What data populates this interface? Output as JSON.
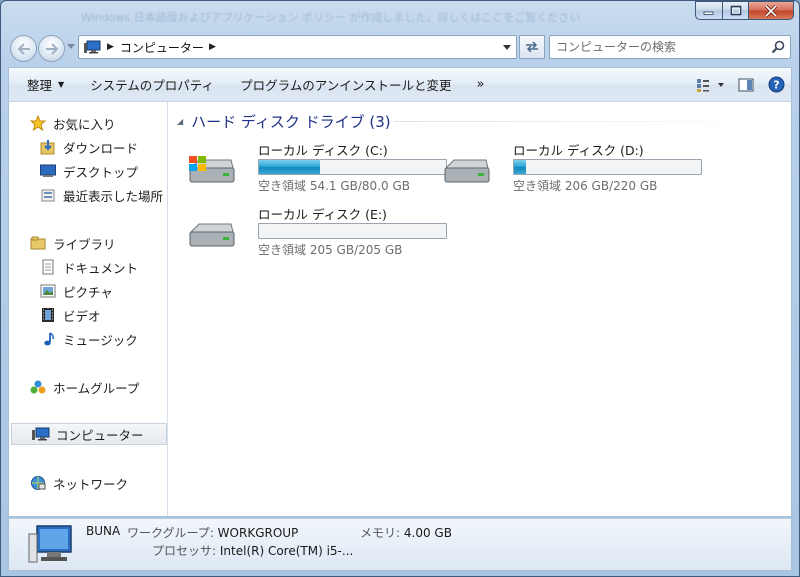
{
  "window": {
    "title_ghost": "Windows 日本語版およびアプリケーション ポリシー が作成しました。詳しくはここをご覧ください"
  },
  "address": {
    "crumb": "コンピューター"
  },
  "search": {
    "placeholder": "コンピューターの検索"
  },
  "toolbar": {
    "organize": "整理",
    "system_properties": "システムのプロパティ",
    "uninstall": "プログラムのアンインストールと変更",
    "more": "»"
  },
  "sidebar": {
    "favorites": "お気に入り",
    "downloads": "ダウンロード",
    "desktop": "デスクトップ",
    "recent": "最近表示した場所",
    "libraries": "ライブラリ",
    "documents": "ドキュメント",
    "pictures": "ピクチャ",
    "videos": "ビデオ",
    "music": "ミュージック",
    "homegroup": "ホームグループ",
    "computer": "コンピューター",
    "network": "ネットワーク"
  },
  "group": {
    "title": "ハード ディスク ドライブ (3)"
  },
  "drives": [
    {
      "name": "ローカル ディスク (C:)",
      "free_text": "空き領域 54.1 GB/80.0 GB",
      "used_fraction": 0.324
    },
    {
      "name": "ローカル ディスク (D:)",
      "free_text": "空き領域 206 GB/220 GB",
      "used_fraction": 0.064
    },
    {
      "name": "ローカル ディスク (E:)",
      "free_text": "空き領域 205 GB/205 GB",
      "used_fraction": 0.0
    }
  ],
  "details": {
    "computer_name": "BUNA",
    "workgroup_label": "ワークグループ:",
    "workgroup_value": "WORKGROUP",
    "memory_label": "メモリ:",
    "memory_value": "4.00 GB",
    "processor_label": "プロセッサ:",
    "processor_value": "Intel(R) Core(TM) i5-..."
  }
}
